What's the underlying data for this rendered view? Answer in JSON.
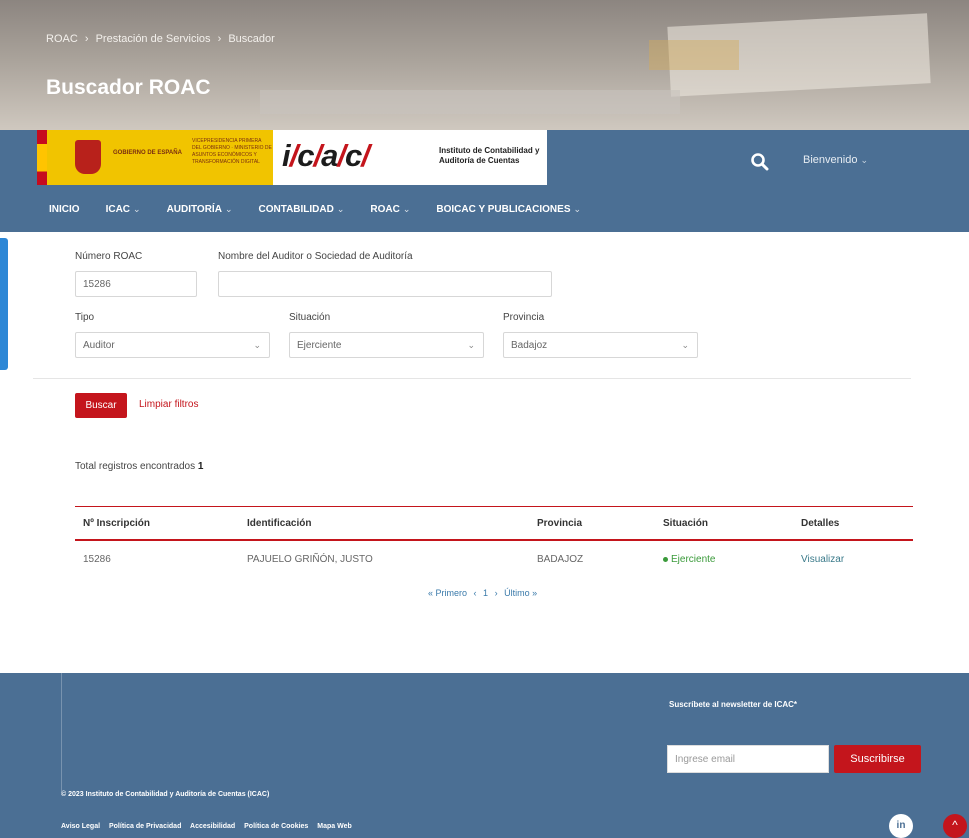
{
  "breadcrumb": [
    "ROAC",
    "›",
    "Prestación de Servicios",
    "›",
    "Buscador"
  ],
  "page_title": "Buscador ROAC",
  "header": {
    "gov_line1": "GOBIERNO DE ESPAÑA",
    "gov_line2": "VICEPRESIDENCIA PRIMERA DEL GOBIERNO · MINISTERIO DE ASUNTOS ECONÓMICOS Y TRANSFORMACIÓN DIGITAL",
    "logo_parts": [
      "i",
      "/",
      "c",
      "/",
      "a",
      "/",
      "c",
      "/"
    ],
    "logo_sub1": "Instituto de Contabilidad y",
    "logo_sub2": "Auditoría de Cuentas",
    "search_icon": "search-icon",
    "welcome": "Bienvenido"
  },
  "nav": [
    {
      "label": "INICIO",
      "caret": false
    },
    {
      "label": "ICAC",
      "caret": true
    },
    {
      "label": "AUDITORÍA",
      "caret": true
    },
    {
      "label": "CONTABILIDAD",
      "caret": true
    },
    {
      "label": "ROAC",
      "caret": true
    },
    {
      "label": "BOICAC Y PUBLICACIONES",
      "caret": true
    }
  ],
  "form": {
    "numero_label": "Número ROAC",
    "numero_value": "15286",
    "nombre_label": "Nombre del Auditor o Sociedad de Auditoría",
    "nombre_value": "",
    "tipo_label": "Tipo",
    "tipo_value": "Auditor",
    "situacion_label": "Situación",
    "situacion_value": "Ejerciente",
    "provincia_label": "Provincia",
    "provincia_value": "Badajoz",
    "buscar_label": "Buscar",
    "limpiar_label": "Limpiar filtros"
  },
  "results": {
    "total_label": "Total registros encontrados",
    "total_count": "1",
    "columns": [
      "Nº Inscripción",
      "Identificación",
      "Provincia",
      "Situación",
      "Detalles"
    ],
    "rows": [
      [
        "15286",
        "PAJUELO GRIÑÓN, JUSTO",
        "BADAJOZ",
        "Ejerciente",
        "Visualizar"
      ]
    ],
    "pager": [
      "« Primero",
      "‹",
      "1",
      "›",
      "Último »"
    ]
  },
  "footer": {
    "newsletter_label": "Suscríbete al newsletter de ICAC*",
    "email_placeholder": "Ingrese email",
    "subscribe_label": "Suscribirse",
    "copyright": "© 2023 Instituto de Contabilidad y Auditoría de Cuentas (ICAC)",
    "links": [
      "Aviso Legal",
      "Política de Privacidad",
      "Accesibilidad",
      "Política de Cookies",
      "Mapa Web"
    ],
    "linkedin": "in",
    "totop": "^"
  },
  "colors": {
    "brand_blue": "#4b6f94",
    "brand_red": "#c4151c",
    "status_green": "#3a9a3a"
  }
}
